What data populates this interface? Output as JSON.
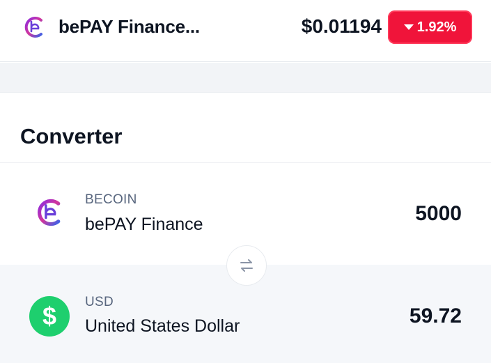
{
  "header": {
    "logo_icon": "bepay-logo-icon",
    "coin_name": "bePAY Finance...",
    "price": "$0.01194",
    "change": "1.92%",
    "change_direction": "down",
    "change_color": "#f0143a"
  },
  "converter": {
    "title": "Converter",
    "swap_icon": "swap-arrows-icon",
    "from": {
      "icon": "bepay-logo-icon",
      "symbol": "BECOIN",
      "name": "bePAY Finance",
      "amount": "5000"
    },
    "to": {
      "icon": "dollar-sign-icon",
      "icon_glyph": "$",
      "icon_color": "#1ecf6e",
      "symbol": "USD",
      "name": "United States Dollar",
      "amount": "59.72"
    }
  }
}
